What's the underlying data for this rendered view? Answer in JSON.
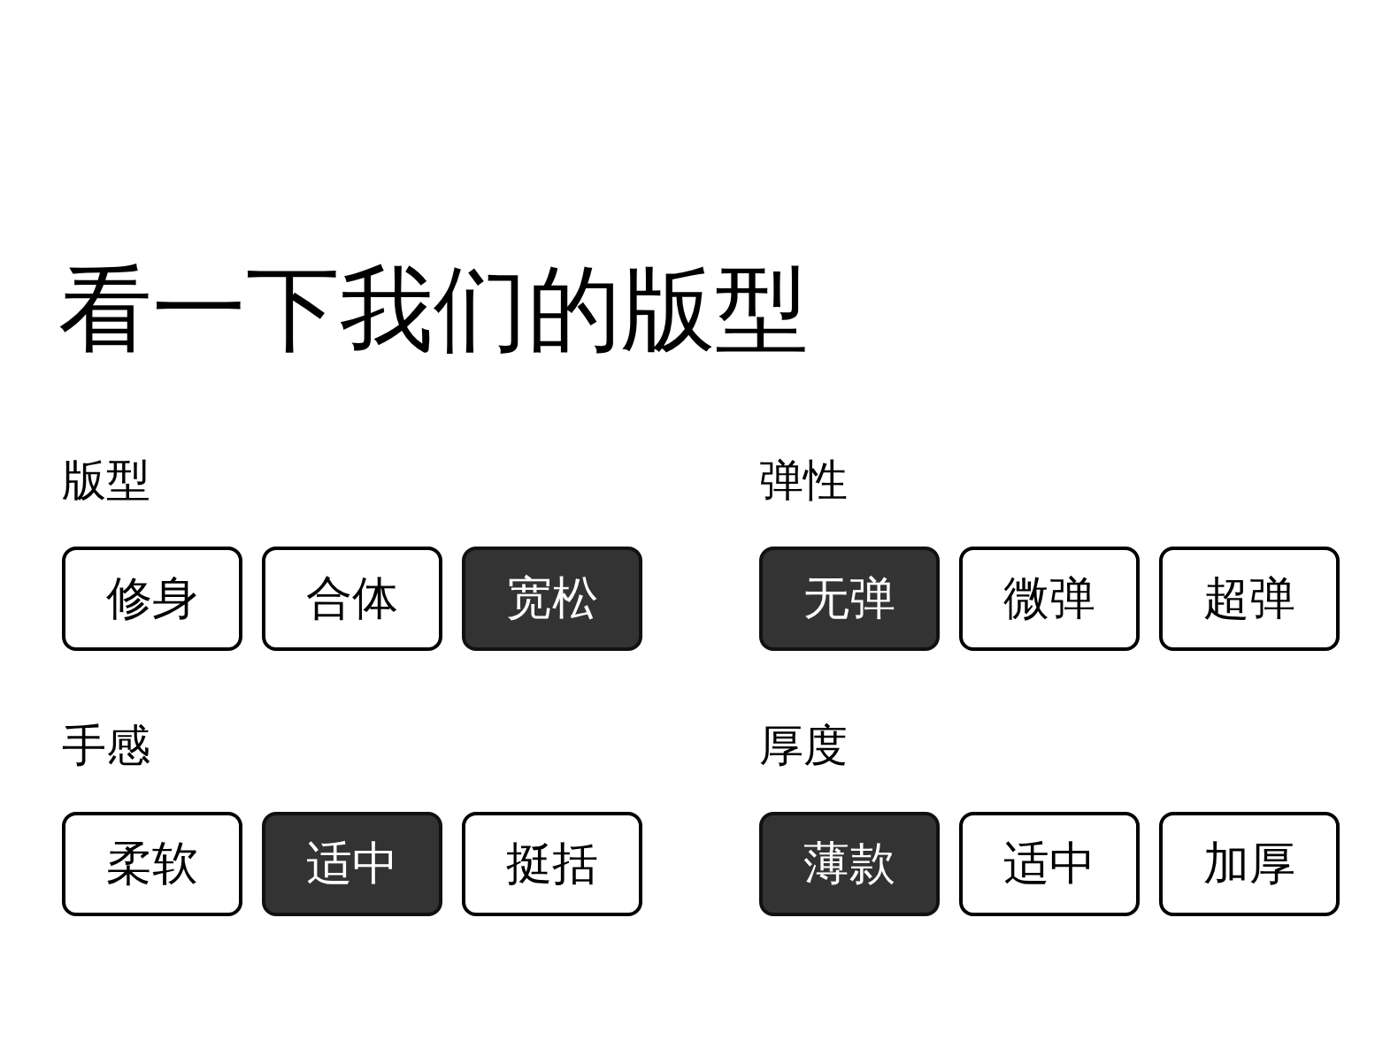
{
  "title": "看一下我们的版型",
  "groups": [
    {
      "label": "版型",
      "options": [
        {
          "label": "修身",
          "selected": false
        },
        {
          "label": "合体",
          "selected": false
        },
        {
          "label": "宽松",
          "selected": true
        }
      ]
    },
    {
      "label": "弹性",
      "options": [
        {
          "label": "无弹",
          "selected": true
        },
        {
          "label": "微弹",
          "selected": false
        },
        {
          "label": "超弹",
          "selected": false
        }
      ]
    },
    {
      "label": "手感",
      "options": [
        {
          "label": "柔软",
          "selected": false
        },
        {
          "label": "适中",
          "selected": true
        },
        {
          "label": "挺括",
          "selected": false
        }
      ]
    },
    {
      "label": "厚度",
      "options": [
        {
          "label": "薄款",
          "selected": true
        },
        {
          "label": "适中",
          "selected": false
        },
        {
          "label": "加厚",
          "selected": false
        }
      ]
    }
  ]
}
